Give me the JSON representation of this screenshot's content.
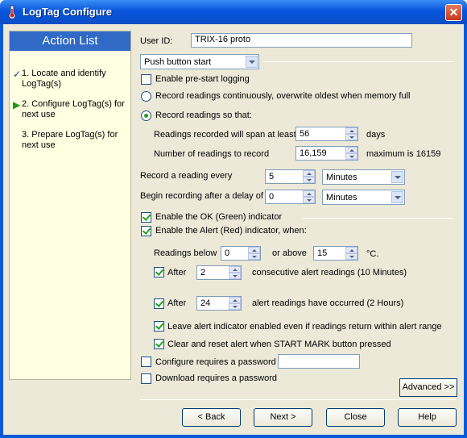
{
  "window": {
    "title": "LogTag Configure",
    "close_glyph": "✕"
  },
  "sidebar": {
    "heading": "Action List",
    "steps": [
      {
        "mark": "✓",
        "label": "1. Locate and identify LogTag(s)"
      },
      {
        "mark": "▶",
        "label": "2. Configure LogTag(s) for next use"
      },
      {
        "mark": "",
        "label": "3. Prepare LogTag(s) for next use"
      }
    ]
  },
  "form": {
    "user_id_label": "User ID:",
    "user_id_value": "TRIX-16 proto",
    "start_mode": "Push button start",
    "prestart_label": "Enable pre-start logging",
    "continuous_label": "Record readings continuously, overwrite oldest when memory full",
    "record_so_label": "Record readings so that:",
    "span_label": "Readings recorded will span at least",
    "span_value": "56",
    "span_unit": "days",
    "count_label": "Number of readings to record",
    "count_value": "16,159",
    "count_max": "maximum is 16159",
    "interval_label": "Record a reading every",
    "interval_value": "5",
    "interval_unit": "Minutes",
    "delay_label": "Begin recording after a delay of",
    "delay_value": "0",
    "delay_unit": "Minutes",
    "ok_indicator_label": "Enable the OK (Green) indicator",
    "alert_indicator_label": "Enable the Alert (Red) indicator, when:",
    "below_label": "Readings below",
    "below_value": "0",
    "above_label": "or above",
    "above_value": "15",
    "temp_unit": "°C.",
    "after_label_1": "After",
    "after_value_1": "2",
    "after_desc_1": "consecutive alert readings (10 Minutes)",
    "after_label_2": "After",
    "after_value_2": "24",
    "after_desc_2": "alert readings have occurred (2 Hours)",
    "leave_alert_label": "Leave alert indicator enabled even if readings return within alert range",
    "clear_alert_label": "Clear and reset alert when START MARK button pressed",
    "config_password_label": "Configure requires a password",
    "config_password_value": "",
    "download_password_label": "Download requires a password"
  },
  "buttons": {
    "advanced": "Advanced >>",
    "back": "< Back",
    "next": "Next >",
    "close": "Close",
    "help": "Help"
  }
}
